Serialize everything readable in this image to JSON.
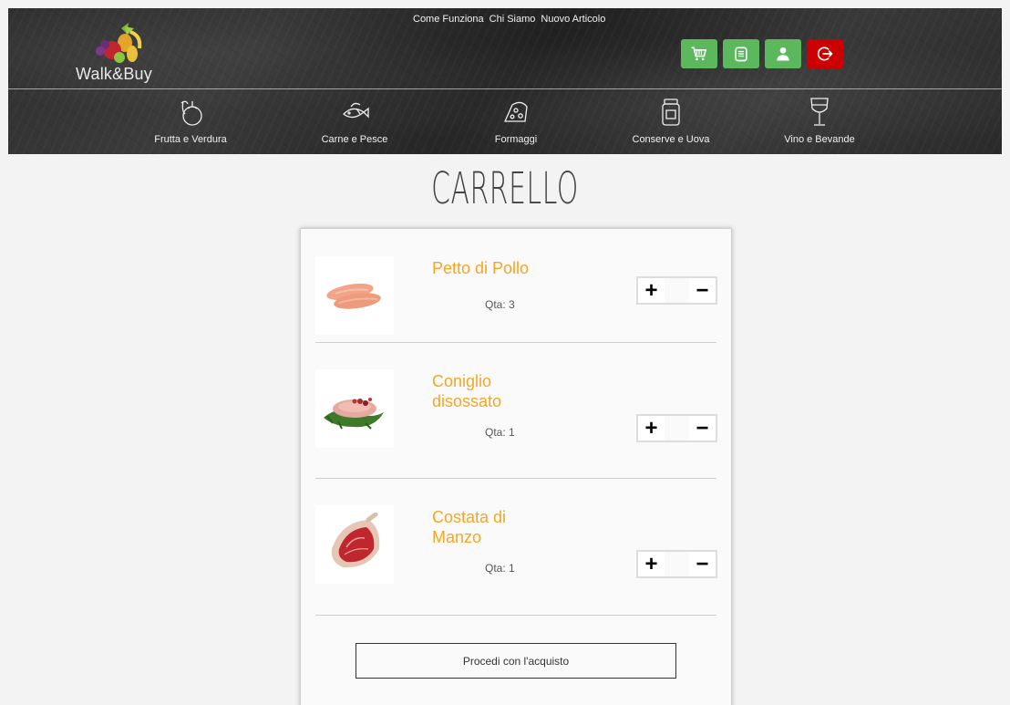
{
  "header": {
    "logo_text": "Walk&Buy",
    "top_links": [
      "Come Funziona",
      "Chi Siamo",
      "Nuovo Articolo"
    ],
    "icon_buttons": [
      {
        "icon": "cart-icon",
        "color": "#5cb85c"
      },
      {
        "icon": "clipboard-icon",
        "color": "#5cb85c"
      },
      {
        "icon": "user-icon",
        "color": "#5cb85c"
      },
      {
        "icon": "logout-icon",
        "color": "#cc0000"
      }
    ],
    "categories": [
      {
        "label": "Frutta e Verdura",
        "icon": "vegetables-icon"
      },
      {
        "label": "Carne e Pesce",
        "icon": "fish-icon"
      },
      {
        "label": "Formaggi",
        "icon": "cheese-icon"
      },
      {
        "label": "Conserve e Uova",
        "icon": "jar-icon"
      },
      {
        "label": "Vino e Bevande",
        "icon": "wine-glass-icon"
      }
    ]
  },
  "page": {
    "title": "CARRELLO"
  },
  "cart": {
    "items": [
      {
        "name": "Petto di Pollo",
        "qty_label": "Qta: 3",
        "image": "chicken-breast-image"
      },
      {
        "name": "Coniglio disossato",
        "qty_label": "Qta: 1",
        "image": "rabbit-image"
      },
      {
        "name": "Costata di Manzo",
        "qty_label": "Qta: 1",
        "image": "beef-rib-image"
      }
    ],
    "plus_label": "+",
    "minus_label": "−",
    "checkout_label": "Procedi con l'acquisto"
  },
  "colors": {
    "accent": "#f5a623",
    "green": "#5cb85c",
    "red": "#cc0000"
  }
}
